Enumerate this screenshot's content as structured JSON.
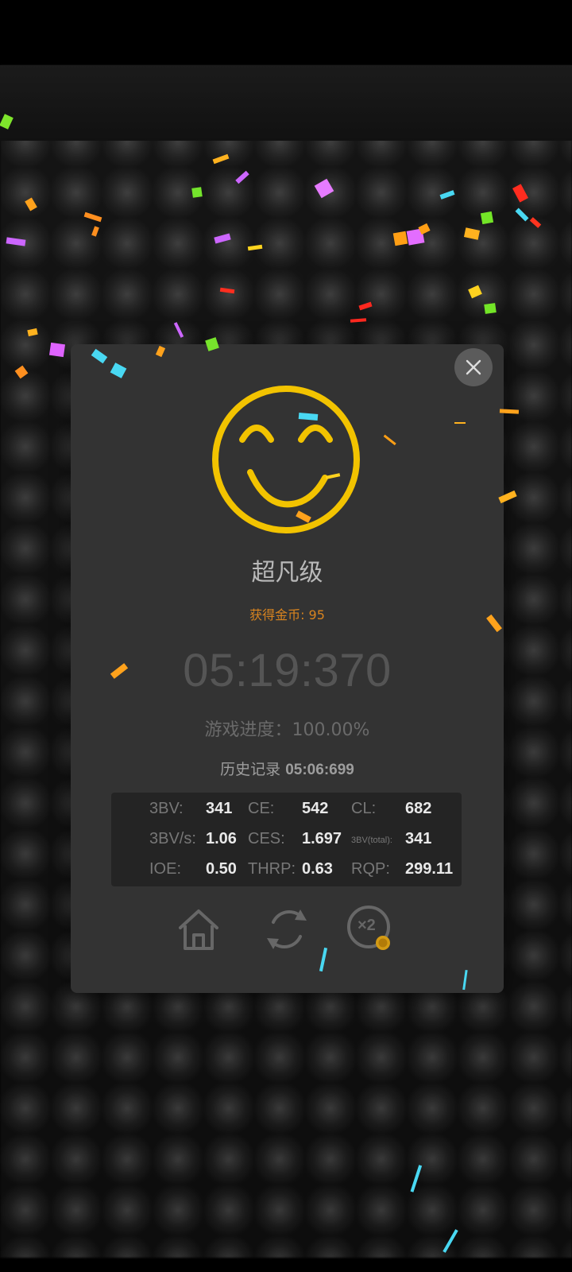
{
  "dialog": {
    "rank": "超凡级",
    "coins": "获得金币: 95",
    "time": "05:19:370",
    "progress": "游戏进度：100.00%",
    "history_label": "历史记录",
    "history_value": "05:06:699",
    "stats": {
      "row1": [
        {
          "label": "3BV:",
          "value": "341"
        },
        {
          "label": "CE:",
          "value": "542"
        },
        {
          "label": "CL:",
          "value": "682"
        }
      ],
      "row2": [
        {
          "label": "3BV/s:",
          "value": "1.06"
        },
        {
          "label": "CES:",
          "value": "1.697"
        },
        {
          "label": "3BV(total):",
          "value": "341"
        }
      ],
      "row3": [
        {
          "label": "IOE:",
          "value": "0.50"
        },
        {
          "label": "THRP:",
          "value": "0.63"
        },
        {
          "label": "RQP:",
          "value": "299.11"
        }
      ]
    },
    "actions": {
      "home_icon": "home-icon",
      "restart_icon": "restart-icon",
      "double_icon": "double-reward-icon",
      "double_label": "×2"
    }
  },
  "colors": {
    "smiley": "#f2c300",
    "coins": "#d9841f",
    "panel": "#333333"
  }
}
